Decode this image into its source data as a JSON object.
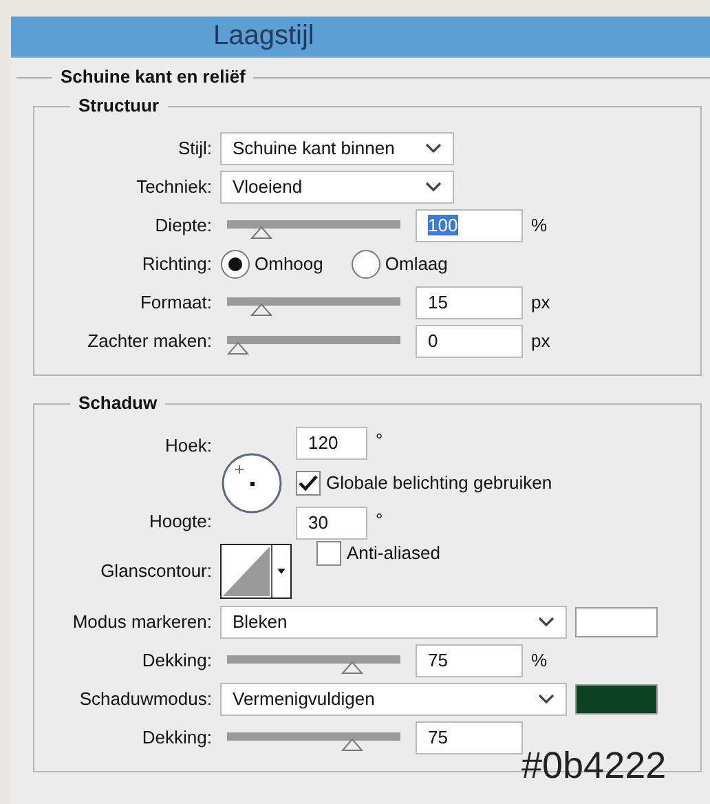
{
  "window": {
    "title": "Laagstijl"
  },
  "section": {
    "title": "Schuine kant en reliëf"
  },
  "groups": [
    {
      "title": "Structuur",
      "rows": [
        {
          "kind": "select",
          "label": "Stijl:",
          "value": "Schuine kant binnen"
        },
        {
          "kind": "select",
          "label": "Techniek:",
          "value": "Vloeiend"
        },
        {
          "kind": "slider",
          "label": "Diepte:",
          "level": 0.15,
          "value": "100",
          "highlighted": true,
          "unit": "%"
        },
        {
          "kind": "radio",
          "label": "Richting:",
          "options": [
            {
              "label": "Omhoog",
              "selected": true
            },
            {
              "label": "Omlaag",
              "selected": false
            }
          ]
        },
        {
          "kind": "slider",
          "label": "Formaat:",
          "level": 0.15,
          "value": "15",
          "highlighted": false,
          "unit": "px"
        },
        {
          "kind": "slider",
          "label": "Zachter maken:",
          "level": 0,
          "value": "0",
          "highlighted": false,
          "unit": "px"
        }
      ]
    },
    {
      "title": "Schaduw",
      "rows": [
        {
          "kind": "lighting",
          "angle_label": "Hoek:",
          "angle": "120",
          "angle_unit": "°",
          "checkbox": {
            "label": "Globale belichting gebruiken",
            "checked": true
          },
          "altitude_label": "Hoogte:",
          "altitude": "30",
          "altitude_unit": "°"
        },
        {
          "kind": "contour",
          "label": "Glanscontour:",
          "checkbox": {
            "label": "Anti-aliased",
            "checked": false
          }
        },
        {
          "kind": "select",
          "label": "Modus markeren:",
          "value": "Bleken",
          "color": "#ffffff"
        },
        {
          "kind": "slider",
          "label": "Dekking:",
          "level": 0.75,
          "value": "75",
          "highlighted": false,
          "unit": "%"
        },
        {
          "kind": "select",
          "label": "Schaduwmodus:",
          "value": "Vermenigvuldigen",
          "color": "#0b4222"
        },
        {
          "kind": "slider",
          "label": "Dekking:",
          "level": 0.75,
          "value": "75",
          "highlighted": false
        }
      ]
    }
  ],
  "annotation": "#0b4222"
}
